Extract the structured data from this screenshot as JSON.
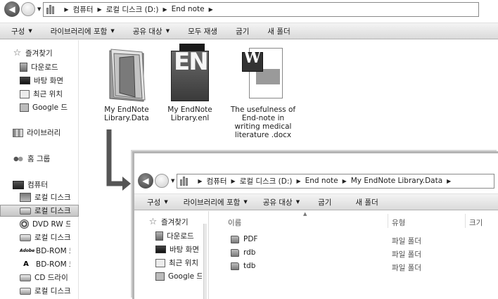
{
  "main_window": {
    "breadcrumb": [
      "컴퓨터",
      "로컬 디스크 (D:)",
      "End note"
    ],
    "toolbar": [
      {
        "label": "구성",
        "has_dropdown": true
      },
      {
        "label": "라이브러리에 포함",
        "has_dropdown": true
      },
      {
        "label": "공유 대상",
        "has_dropdown": true
      },
      {
        "label": "모두 재생",
        "has_dropdown": false
      },
      {
        "label": "굽기",
        "has_dropdown": false
      },
      {
        "label": "새 폴더",
        "has_dropdown": false
      }
    ],
    "nav": {
      "favorites": "즐겨찾기",
      "downloads": "다운로드",
      "desktop": "바탕 화면",
      "recent": "최근 위치",
      "google_drive": "Google 드",
      "libraries": "라이브러리",
      "homegroup": "홈 그룹",
      "computer": "컴퓨터",
      "drives": [
        {
          "label": "로컬 디스크",
          "icon": "system-drive-icon"
        },
        {
          "label": "로컬 디스크",
          "icon": "drive-icon",
          "selected": true
        },
        {
          "label": "DVD RW 드",
          "icon": "dvd-icon"
        },
        {
          "label": "로컬 디스크",
          "icon": "drive-icon"
        },
        {
          "label": "BD-ROM 드",
          "icon": "bd-icon"
        },
        {
          "label": "BD-ROM 드",
          "icon": "bd-a-icon"
        },
        {
          "label": "CD 드라이",
          "icon": "drive-icon"
        },
        {
          "label": "로컬 디스크",
          "icon": "drive-icon"
        }
      ]
    },
    "files": [
      {
        "line1": "My EndNote",
        "line2": "Library.Data",
        "icon": "folder-icon"
      },
      {
        "line1": "My EndNote",
        "line2": "Library.enl",
        "icon": "endnote-icon",
        "icon_text": "EN"
      },
      {
        "line1": "The usefulness of",
        "line2": "End-note in",
        "line3": "writing medical",
        "line4": "literature .docx",
        "icon": "word-document-icon",
        "icon_text": "W"
      }
    ]
  },
  "child_window": {
    "breadcrumb": [
      "컴퓨터",
      "로컬 디스크 (D:)",
      "End note",
      "My EndNote Library.Data"
    ],
    "toolbar": [
      {
        "label": "구성",
        "has_dropdown": true
      },
      {
        "label": "라이브러리에 포함",
        "has_dropdown": true
      },
      {
        "label": "공유 대상",
        "has_dropdown": true
      },
      {
        "label": "굽기",
        "has_dropdown": false
      },
      {
        "label": "새 폴더",
        "has_dropdown": false
      }
    ],
    "nav": {
      "favorites": "즐겨찾기",
      "downloads": "다운로드",
      "desktop": "바탕 화면",
      "recent": "최근 위치",
      "google_drive": "Google 드"
    },
    "columns": {
      "name": "이름",
      "type": "유형",
      "size": "크기"
    },
    "rows": [
      {
        "name": "PDF",
        "type": "파일 폴더"
      },
      {
        "name": "rdb",
        "type": "파일 폴더"
      },
      {
        "name": "tdb",
        "type": "파일 폴더"
      }
    ]
  },
  "colors": {
    "toolbar_top": "#f4f4f4",
    "toolbar_bottom": "#dadada",
    "arrow": "#555555",
    "text": "#1c1c1c"
  }
}
